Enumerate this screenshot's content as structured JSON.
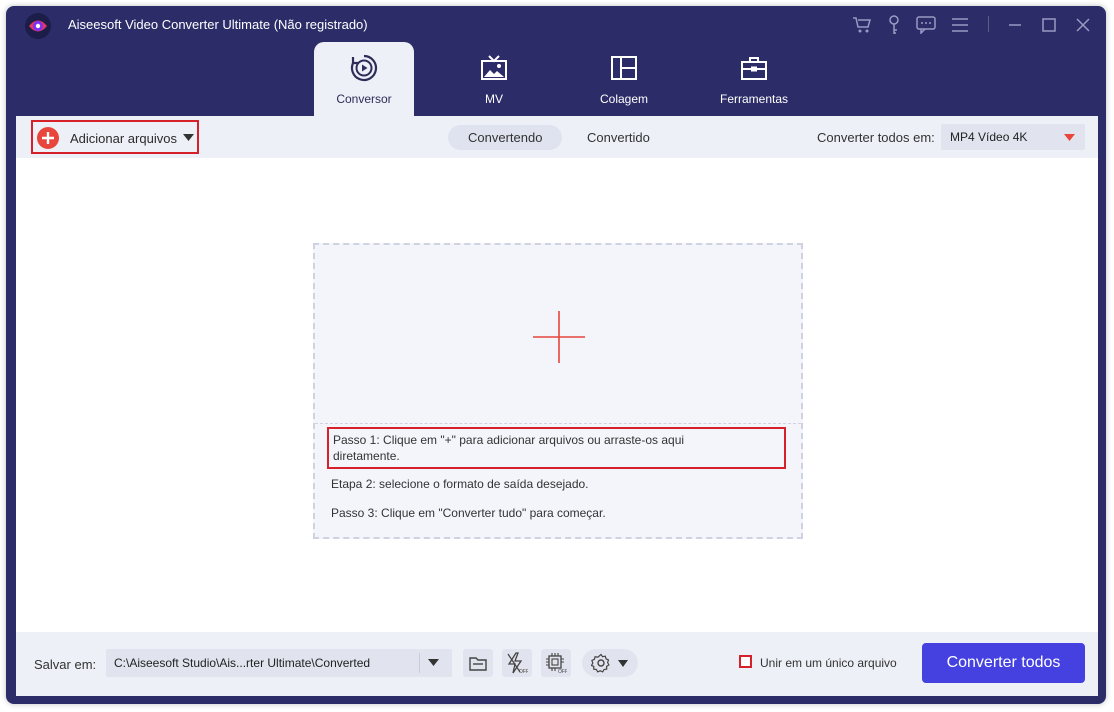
{
  "app": {
    "title": "Aiseesoft Video Converter Ultimate (Não registrado)"
  },
  "tabs": [
    {
      "label": "Conversor",
      "icon": "converter-icon",
      "active": true
    },
    {
      "label": "MV",
      "icon": "tv-icon",
      "active": false
    },
    {
      "label": "Colagem",
      "icon": "collage-icon",
      "active": false
    },
    {
      "label": "Ferramentas",
      "icon": "toolbox-icon",
      "active": false
    }
  ],
  "toolbar": {
    "add_files_label": "Adicionar arquivos",
    "segments": [
      {
        "label": "Convertendo",
        "active": true
      },
      {
        "label": "Convertido",
        "active": false
      }
    ],
    "convert_all_label": "Converter todos em:",
    "format_value": "MP4 Vídeo 4K"
  },
  "dropzone": {
    "step1": "Passo 1: Clique em \"+\" para adicionar arquivos ou arraste-os aqui diretamente.",
    "step2": "Etapa 2: selecione o formato de saída desejado.",
    "step3": "Passo 3: Clique em \"Converter tudo\" para começar."
  },
  "bottom": {
    "save_label": "Salvar em:",
    "save_path": "C:\\Aiseesoft Studio\\Ais...rter Ultimate\\Converted",
    "merge_label": "Unir em um único arquivo",
    "convert_all_button": "Converter todos"
  },
  "colors": {
    "window_bg": "#2c2c69",
    "accent_red": "#d6202a",
    "primary_button": "#4541e0",
    "panel_bg": "#eef0f7"
  }
}
